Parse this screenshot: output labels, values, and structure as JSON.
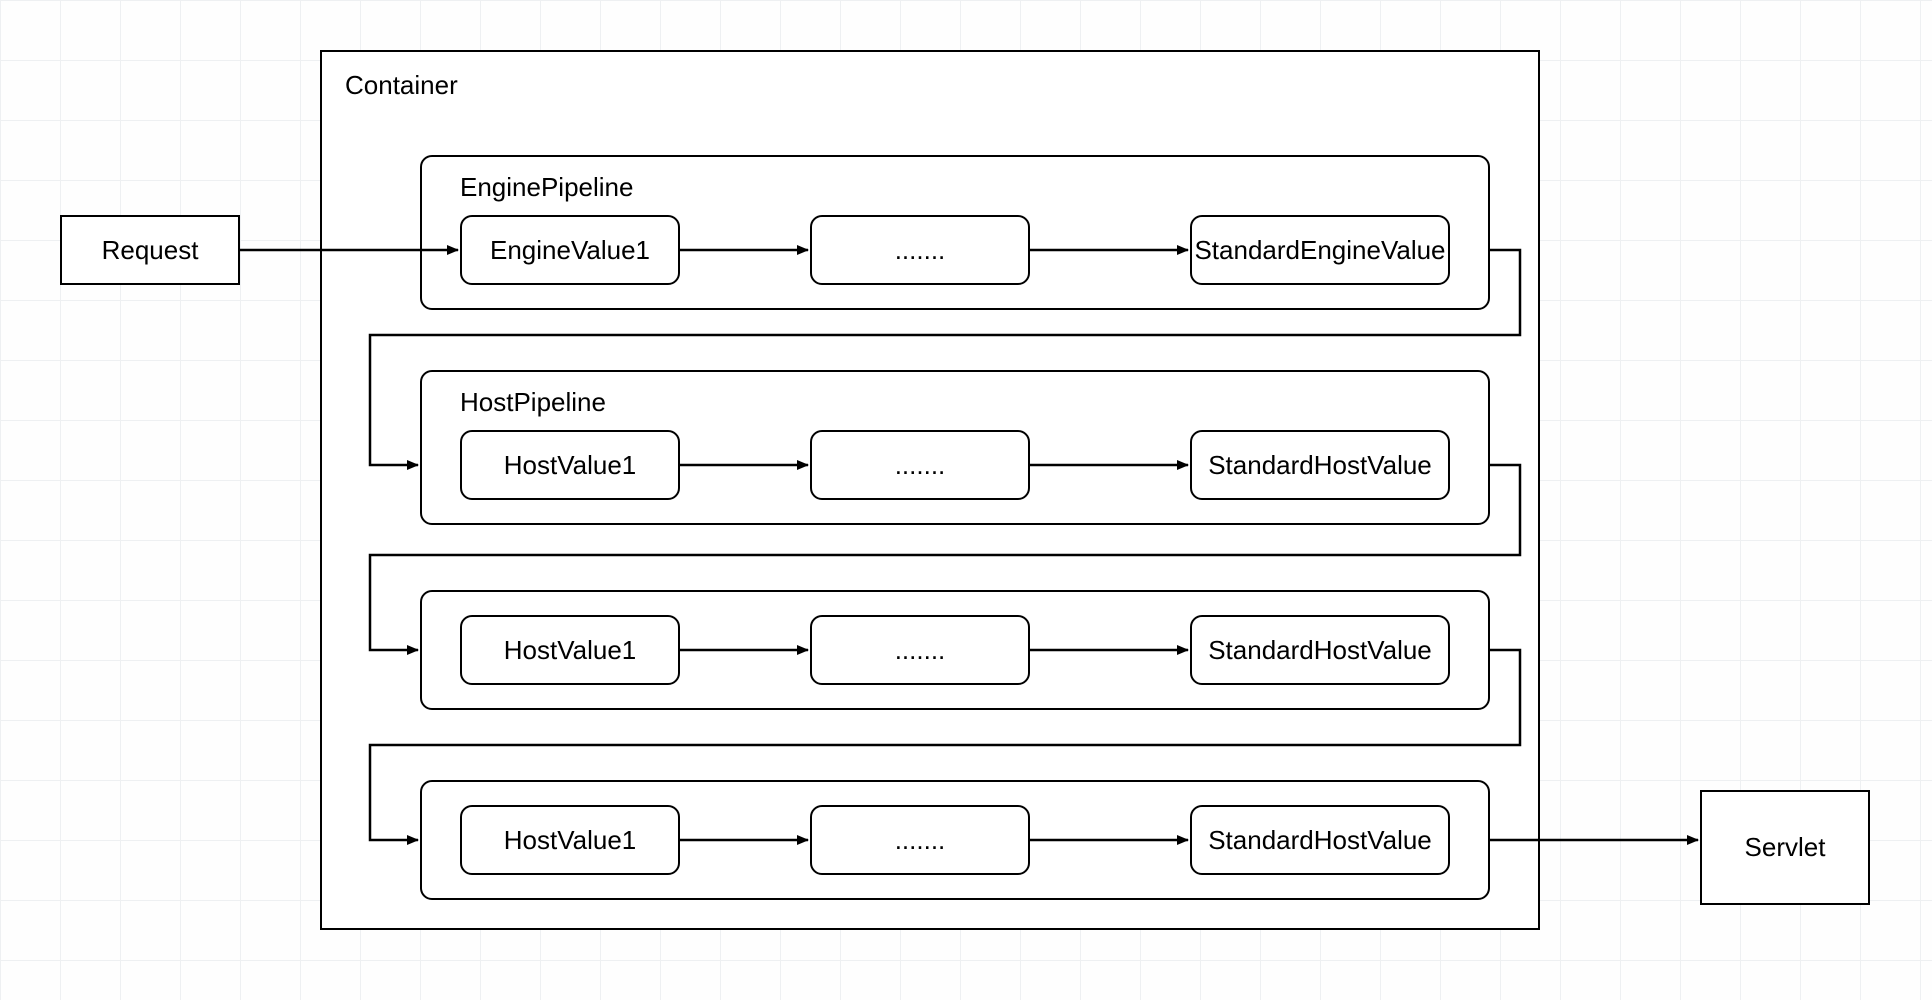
{
  "request": {
    "label": "Request"
  },
  "servlet": {
    "label": "Servlet"
  },
  "container": {
    "title": "Container"
  },
  "pipelines": [
    {
      "title": "EnginePipeline",
      "values": [
        "EngineValue1",
        ".......",
        "StandardEngineValue"
      ]
    },
    {
      "title": "HostPipeline",
      "values": [
        "HostValue1",
        ".......",
        "StandardHostValue"
      ]
    },
    {
      "title": "",
      "values": [
        "HostValue1",
        ".......",
        "StandardHostValue"
      ]
    },
    {
      "title": "",
      "values": [
        "HostValue1",
        ".......",
        "StandardHostValue"
      ]
    }
  ],
  "watermark": ""
}
